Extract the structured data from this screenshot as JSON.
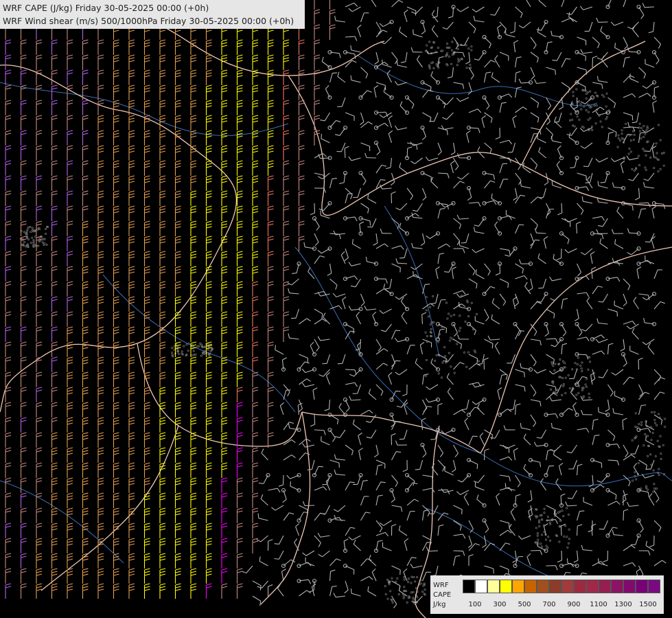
{
  "titles": {
    "line1": "WRF CAPE (J/kg) Friday 30-05-2025 00:00 (+0h)",
    "line2": "WRF Wind shear (m/s) 500/1000hPa Friday 30-05-2025 00:00 (+0h)"
  },
  "legend": {
    "label_top": "WRF",
    "label_mid": "CAPE",
    "label_unit": "J/kg",
    "ticks": [
      "100",
      "300",
      "500",
      "700",
      "900",
      "1100",
      "1300",
      "1500"
    ],
    "colors": [
      "#000000",
      "#ffffff",
      "#ffff99",
      "#ffff00",
      "#ffa500",
      "#c86400",
      "#a0501e",
      "#8c3c28",
      "#a03c3c",
      "#9a2a40",
      "#a02848",
      "#961e50",
      "#8c1464",
      "#820a6e",
      "#780078",
      "#7a0a82"
    ]
  },
  "map_colors": {
    "background": "#000000",
    "border": "#f0c8b4",
    "river": "#3c6eb4",
    "barb_calm": "#b4b4b4",
    "barb_low": "#c88c82",
    "barb_mid": "#f07864",
    "barb_high": "#ffff00",
    "barb_orange": "#e6a050",
    "barb_magenta": "#ff00ff",
    "barb_violet": "#b464e6"
  }
}
